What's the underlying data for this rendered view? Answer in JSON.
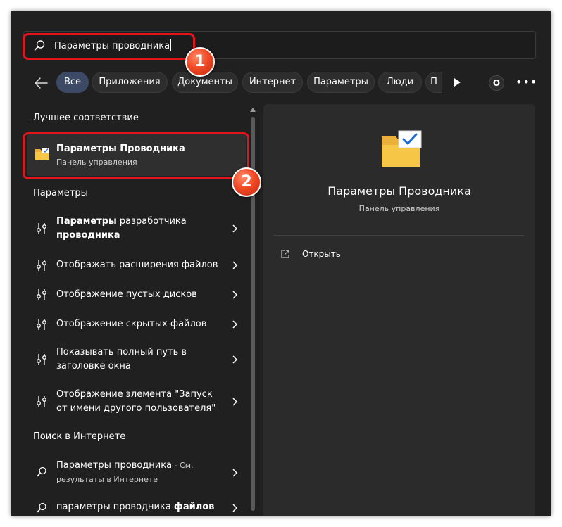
{
  "search": {
    "value": "Параметры проводника"
  },
  "filters": {
    "chips": [
      "Все",
      "Приложения",
      "Документы",
      "Интернет",
      "Параметры",
      "Люди",
      "П"
    ],
    "profile_label": "O",
    "more_label": "•••"
  },
  "best_match": {
    "heading": "Лучшее соответствие",
    "title": "Параметры Проводника",
    "subtitle": "Панель управления"
  },
  "settings": {
    "heading": "Параметры",
    "items": [
      {
        "bold": "Параметры",
        "rest": " разработчика",
        "line2_bold": "проводника"
      },
      {
        "text": "Отображать расширения файлов"
      },
      {
        "text": "Отображение пустых дисков"
      },
      {
        "text": "Отображение скрытых файлов"
      },
      {
        "line1": "Показывать полный путь в",
        "line2": "заголовке окна"
      },
      {
        "line1": "Отображение элемента \"Запуск",
        "line2": "от имени другого пользователя\""
      }
    ]
  },
  "web": {
    "heading": "Поиск в Интернете",
    "items": [
      {
        "text": "Параметры проводника",
        "suffix": " - См.",
        "sub": "результаты в Интернете"
      },
      {
        "text": "параметры проводника ",
        "bold": "файлов"
      }
    ]
  },
  "preview": {
    "title": "Параметры Проводника",
    "subtitle": "Панель управления",
    "open_label": "Открыть"
  },
  "annotations": {
    "badge_1": "1",
    "badge_2": "2"
  },
  "colors": {
    "window_bg": "#202020",
    "panel_bg": "#2b2b2b",
    "chip_bg": "#2d2d2d",
    "chip_active_bg": "#3d4a66",
    "highlight_red": "#e5131a",
    "badge_orange": "#f04a26",
    "folder_yellow": "#f6c646"
  }
}
